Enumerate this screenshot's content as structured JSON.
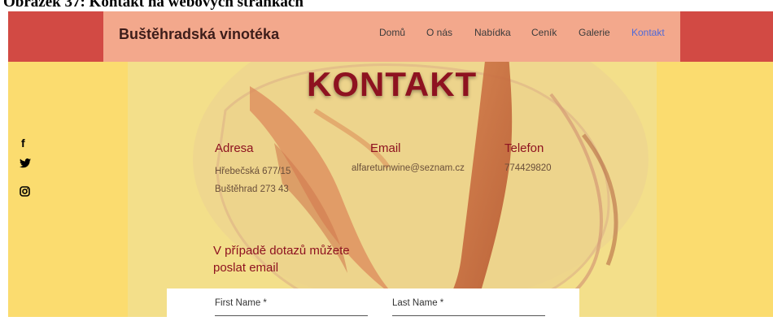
{
  "caption": "Obrázek 37: Kontakt na webových stránkách",
  "header": {
    "brand": "Buštěhradská vinotéka",
    "nav": [
      "Domů",
      "O nás",
      "Nabídka",
      "Ceník",
      "Galerie",
      "Kontakt"
    ],
    "active_nav": "Kontakt"
  },
  "page": {
    "title": "KONTAKT",
    "social": [
      "facebook-icon",
      "twitter-icon",
      "instagram-icon"
    ],
    "address": {
      "heading": "Adresa",
      "line1": "Hřebečská 677/15",
      "line2": "Buštěhrad 273 43"
    },
    "email": {
      "heading": "Email",
      "value": "alfareturnwine@seznam.cz"
    },
    "phone": {
      "heading": "Telefon",
      "value": "774429820"
    },
    "question": {
      "line1": "V případě dotazů můžete",
      "line2": "poslat email"
    },
    "form": {
      "first_name_label": "First Name *",
      "last_name_label": "Last Name *"
    }
  },
  "colors": {
    "header_outer": "#d24a44",
    "header_inner": "#f3a88c",
    "background": "#fbdc6f",
    "title": "#8e1220",
    "active_nav": "#4f6ad8"
  }
}
